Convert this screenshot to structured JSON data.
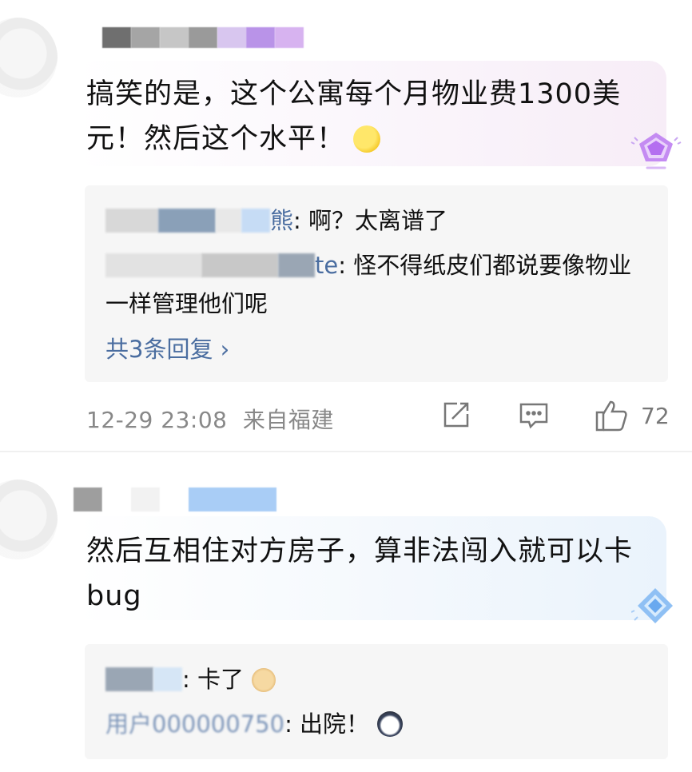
{
  "comments": [
    {
      "text": "搞笑的是，这个公寓每个月物业费1300美元！然后这个水平！",
      "replies": [
        {
          "name_tail": "熊",
          "text": ": 啊？太离谱了"
        },
        {
          "name_tail": "te",
          "text": ": 怪不得纸皮们都说要像物业一样管理他们呢"
        }
      ],
      "more_replies": "共3条回复 ›",
      "time": "12-29 23:08",
      "location": "来自福建",
      "like_count": "72",
      "icons": {
        "share": "share-icon",
        "comment": "comment-icon",
        "like": "like-icon",
        "badge": "purple-gem-badge-icon",
        "emoji": "grimace-emoji-icon"
      }
    },
    {
      "text": "然后互相住对方房子，算非法闯入就可以卡bug",
      "replies": [
        {
          "name_tail": "",
          "text": ": 卡了"
        },
        {
          "name_tail": "用户000000750",
          "text": ": 出院！"
        }
      ],
      "icons": {
        "badge": "blue-gem-badge-icon",
        "emoji1": "doge-emoji-icon",
        "emoji2": "husky-emoji-icon"
      }
    }
  ]
}
